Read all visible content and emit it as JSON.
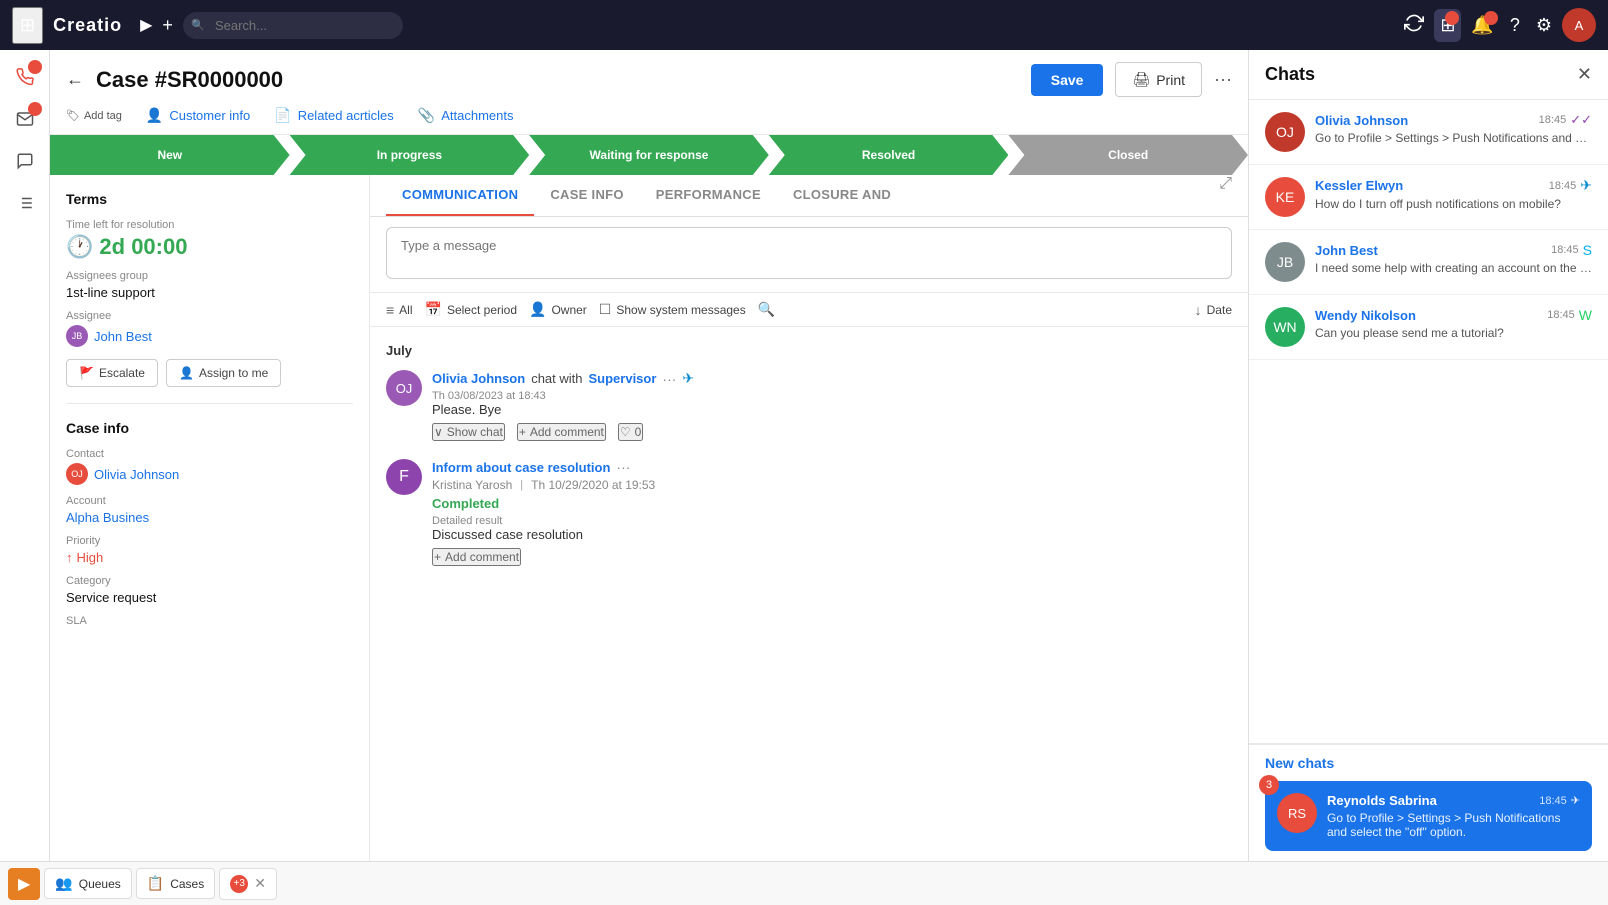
{
  "topnav": {
    "logo": "Creatio",
    "search_placeholder": "Search...",
    "icons": [
      "⚙",
      "⊞",
      "🔔",
      "?",
      "⚙"
    ]
  },
  "case": {
    "title": "Case #SR0000000",
    "save_btn": "Save",
    "print_btn": "Print",
    "add_tag": "Add tag",
    "customer_info": "Customer info",
    "related_articles": "Related acrticles",
    "attachments": "Attachments"
  },
  "status_steps": [
    {
      "label": "New",
      "state": "active"
    },
    {
      "label": "In progress",
      "state": "active"
    },
    {
      "label": "Waiting for response",
      "state": "active"
    },
    {
      "label": "Resolved",
      "state": "active"
    },
    {
      "label": "Closed",
      "state": "inactive"
    }
  ],
  "terms": {
    "title": "Terms",
    "time_left_label": "Time left for resolution",
    "timer": "2d 00:00",
    "assignees_group_label": "Assignees group",
    "assignees_group": "1st-line support",
    "assignee_label": "Assignee",
    "assignee": "John Best",
    "escalate_btn": "Escalate",
    "assign_to_me_btn": "Assign to me"
  },
  "case_info": {
    "title": "Case info",
    "contact_label": "Contact",
    "contact": "Olivia Johnson",
    "account_label": "Account",
    "account": "Alpha Busines",
    "priority_label": "Priority",
    "priority": "High",
    "category_label": "Category",
    "category": "Service request",
    "sla_label": "SLA"
  },
  "tabs": [
    {
      "label": "COMMUNICATION",
      "active": true
    },
    {
      "label": "CASE INFO",
      "active": false
    },
    {
      "label": "PERFORMANCE",
      "active": false
    },
    {
      "label": "CLOSURE AND",
      "active": false
    }
  ],
  "message_placeholder": "Type a message",
  "filters": [
    {
      "icon": "≡",
      "label": "All"
    },
    {
      "icon": "📅",
      "label": "Select period"
    },
    {
      "icon": "👤",
      "label": "Owner"
    },
    {
      "icon": "☐",
      "label": "Show system messages"
    },
    {
      "icon": "🔍",
      "label": ""
    },
    {
      "icon": "↓",
      "label": "Date"
    }
  ],
  "month": "July",
  "messages": [
    {
      "id": "msg1",
      "author": "Olivia Johnson",
      "action": "chat with",
      "with": "Supervisor",
      "time": "Th 03/08/2023 at 18:43",
      "text": "Please. Bye",
      "show_chat": "Show chat",
      "add_comment": "Add comment",
      "likes": "0"
    },
    {
      "id": "msg2",
      "author": "Inform about case resolution",
      "sub_author": "Kristina Yarosh",
      "time": "Th 10/29/2020 at 19:53",
      "status": "Completed",
      "result_label": "Detailed result",
      "result": "Discussed case resolution",
      "add_comment": "Add comment"
    }
  ],
  "chats": {
    "title": "Chats",
    "items": [
      {
        "name": "Olivia Johnson",
        "time": "18:45",
        "channel": "double-check",
        "message": "Go to Profile > Settings > Push Notifications and search to off.",
        "avatar_color": "#c0392b"
      },
      {
        "name": "Kessler Elwyn",
        "time": "18:45",
        "channel": "telegram",
        "message": "How do I turn off push notifications on mobile?",
        "avatar_color": "#e74c3c"
      },
      {
        "name": "John Best",
        "time": "18:45",
        "channel": "skype",
        "message": "I need some help with creating an account on the website. Could you send me an instruction?",
        "avatar_color": "#7f8c8d"
      },
      {
        "name": "Wendy Nikolson",
        "time": "18:45",
        "channel": "whatsapp",
        "message": "Can you please send me a tutorial?",
        "avatar_color": "#27ae60"
      }
    ],
    "new_chats_title": "New chats",
    "new_chats_badge": "3",
    "new_chat": {
      "name": "Reynolds Sabrina",
      "time": "18:45",
      "channel": "telegram",
      "message": "Go to Profile > Settings > Push Notifications and select the \"off\" option.",
      "avatar_color": "#e74c3c"
    }
  },
  "taskbar": {
    "queues_label": "Queues",
    "cases_label": "Cases",
    "count_badge": "+3"
  }
}
